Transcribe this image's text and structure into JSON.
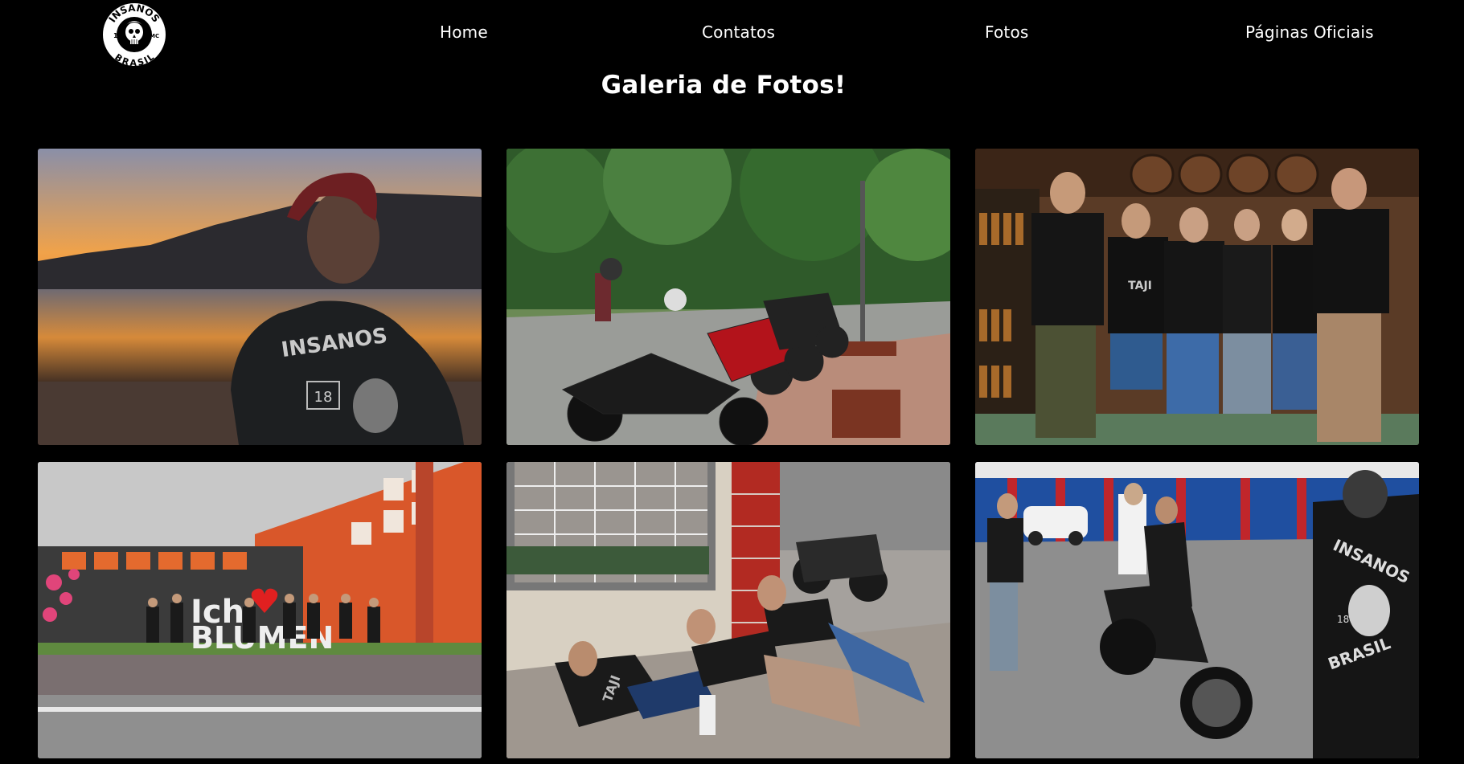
{
  "header": {
    "logo": {
      "top_text": "INSANOS",
      "bottom_text": "BRASIL",
      "left_badge": "18",
      "right_badge": "MC",
      "icon": "skull-icon"
    },
    "nav": {
      "home": "Home",
      "contatos": "Contatos",
      "fotos": "Fotos",
      "oficiais": "Páginas Oficiais"
    }
  },
  "page": {
    "title": "Galeria de Fotos!"
  },
  "gallery": {
    "photos": [
      {
        "subject": "sunset-beach-biker-back",
        "vest_text": "INSANOS",
        "patch": "18"
      },
      {
        "subject": "motorcycles-parked-roadside"
      },
      {
        "subject": "group-in-bar-with-barrels",
        "vest_text": "TAJI"
      },
      {
        "subject": "group-at-blumenau-sign",
        "sign_text": "Ich",
        "sign_text2": "BLUMEN"
      },
      {
        "subject": "bikers-lying-on-sidewalk",
        "vest_text": "TAJI"
      },
      {
        "subject": "bikers-with-motorcycle-parking-lot",
        "vest_top": "INSANOS",
        "vest_bottom": "BRASIL",
        "patch": "18"
      }
    ]
  },
  "colors": {
    "background": "#000000",
    "text": "#ffffff"
  }
}
